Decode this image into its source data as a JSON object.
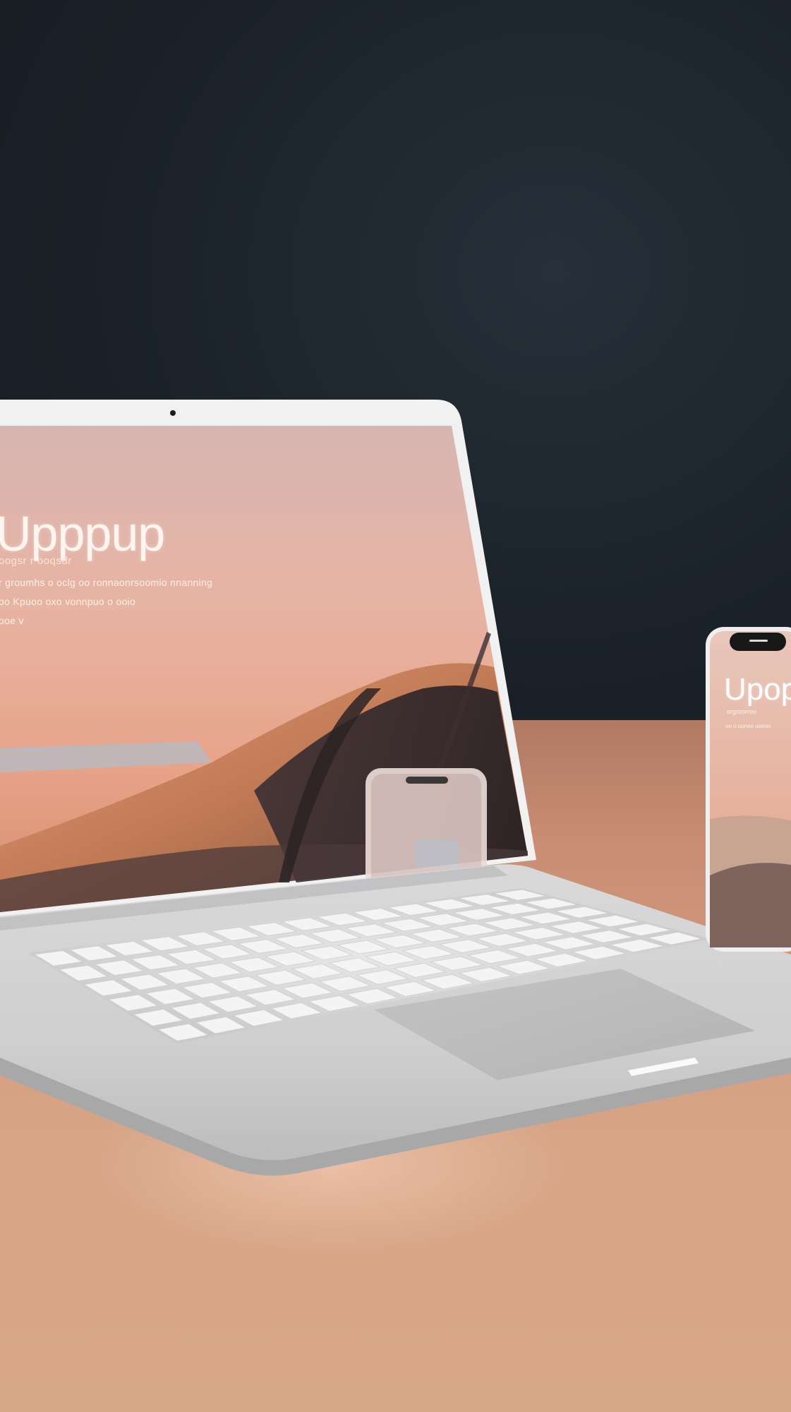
{
  "scene": {
    "description_kind": "product-mockup",
    "colors": {
      "background": "#1b2229",
      "desk": "#d7a385",
      "device_silver": "#e6e6e6",
      "screen_sky": "#e8b7a2",
      "dune": "#c8845e"
    }
  },
  "laptop": {
    "screen": {
      "title": "Upppup",
      "subtitle": "oogsr r ooqsdr",
      "lines": [
        "r groumhs o oclg oo ronnaonrsoomio nnanning",
        "oo Kpuoo oxo vonnpuo o ooio",
        "ooe v"
      ]
    }
  },
  "phone": {
    "screen": {
      "title": "Upop",
      "subtitle": "orgroorroo",
      "line": "oo o oonoo oonoo"
    }
  }
}
